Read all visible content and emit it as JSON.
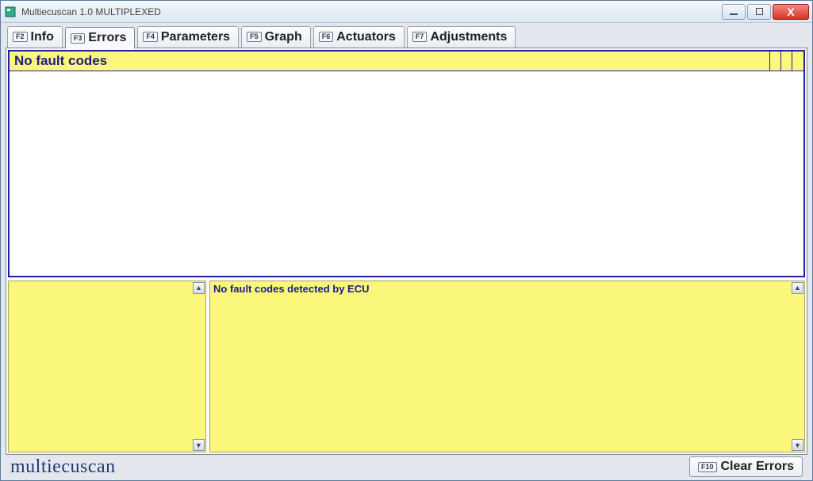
{
  "window": {
    "title": "Multiecuscan 1.0 MULTIPLEXED"
  },
  "tabs": [
    {
      "fkey": "F2",
      "label": "Info"
    },
    {
      "fkey": "F3",
      "label": "Errors"
    },
    {
      "fkey": "F4",
      "label": "Parameters"
    },
    {
      "fkey": "F5",
      "label": "Graph"
    },
    {
      "fkey": "F6",
      "label": "Actuators"
    },
    {
      "fkey": "F7",
      "label": "Adjustments"
    }
  ],
  "active_tab_index": 1,
  "errors_panel": {
    "header": "No fault codes",
    "detail_message": "No fault codes detected by ECU"
  },
  "footer": {
    "brand": "multiecuscan",
    "clear_button": {
      "fkey": "F10",
      "label": "Clear Errors"
    }
  },
  "colors": {
    "highlight_bg": "#faf77a",
    "accent_text": "#1a1a90",
    "panel_border": "#2020a0"
  }
}
